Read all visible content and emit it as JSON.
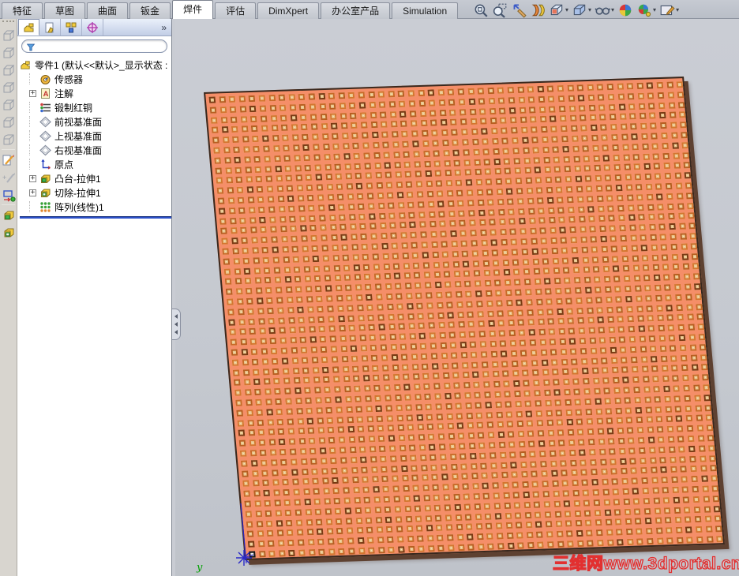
{
  "command_tabs": [
    {
      "label": "特征",
      "active": false
    },
    {
      "label": "草图",
      "active": false
    },
    {
      "label": "曲面",
      "active": false
    },
    {
      "label": "钣金",
      "active": false
    },
    {
      "label": "焊件",
      "active": true
    },
    {
      "label": "评估",
      "active": false
    },
    {
      "label": "DimXpert",
      "active": false
    },
    {
      "label": "办公室产品",
      "active": false
    },
    {
      "label": "Simulation",
      "active": false
    }
  ],
  "headsup_toolbar": [
    {
      "name": "zoom-to-fit",
      "dropdown": false
    },
    {
      "name": "zoom-to-area",
      "dropdown": false
    },
    {
      "name": "previous-view",
      "dropdown": false
    },
    {
      "name": "section-view",
      "dropdown": false
    },
    {
      "name": "view-orientation",
      "dropdown": true
    },
    {
      "name": "display-style",
      "dropdown": true
    },
    {
      "name": "hide-show-items",
      "dropdown": true
    },
    {
      "name": "edit-appearance",
      "dropdown": false
    },
    {
      "name": "apply-scene",
      "dropdown": true
    },
    {
      "name": "view-settings",
      "dropdown": true
    }
  ],
  "left_toolbar": [
    "view-cube",
    "view-cube",
    "view-cube",
    "view-cube",
    "view-cube",
    "view-cube",
    "view-cube-iso",
    "sep",
    "sketch",
    "sketch-3d",
    "convert-entities",
    "sep",
    "extrude-boss",
    "extrude-boss-alt"
  ],
  "feature_panel": {
    "tabs": [
      "featuremanager",
      "propertymanager",
      "configurationmanager",
      "dimxpertmanager"
    ],
    "chevron": "»",
    "filter_value": "",
    "root_label": "零件1 (默认<<默认>_显示状态 :",
    "items": [
      {
        "label": "传感器",
        "icon": "sensors",
        "expand": false
      },
      {
        "label": "注解",
        "icon": "annotations",
        "expand": true
      },
      {
        "label": "锻制红铜",
        "icon": "material",
        "expand": false
      },
      {
        "label": "前视基准面",
        "icon": "plane",
        "expand": false
      },
      {
        "label": "上视基准面",
        "icon": "plane",
        "expand": false
      },
      {
        "label": "右视基准面",
        "icon": "plane",
        "expand": false
      },
      {
        "label": "原点",
        "icon": "origin",
        "expand": false
      },
      {
        "label": "凸台-拉伸1",
        "icon": "boss-extrude",
        "expand": true
      },
      {
        "label": "切除-拉伸1",
        "icon": "cut-extrude",
        "expand": true
      },
      {
        "label": "阵列(线性)1",
        "icon": "linear-pattern",
        "expand": false
      }
    ]
  },
  "viewport": {
    "watermark": "三维网www.3dportal.cn",
    "axis_label_y": "y",
    "plate": {
      "cols": 48,
      "rows": 46,
      "col_spacing": 12.6,
      "row_spacing": 12.8,
      "cell_size": 8,
      "offset": 4,
      "colors": {
        "base": "#F58E68",
        "ring": "#C96A28",
        "ring_variants": [
          "#C96A28",
          "#B85E20",
          "#D4762F"
        ],
        "speck": "#7A3A12",
        "fill": "#EBC98E",
        "center": "#F7ECCE",
        "edge": "#38281E",
        "side": "#5E4131",
        "seed_border": "#141414",
        "seed_fill": "#E9E9E9"
      }
    },
    "origin_color": "#2828C8",
    "axis_y_color": "#00A000",
    "watermark_stroke": "#E23030"
  }
}
